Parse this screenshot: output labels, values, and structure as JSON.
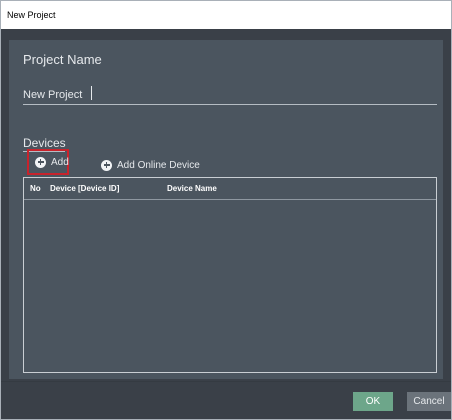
{
  "window": {
    "title": "New Project"
  },
  "project_name": {
    "heading": "Project Name",
    "value": "New Project"
  },
  "devices": {
    "heading": "Devices",
    "add_label": "Add",
    "add_online_label": "Add Online Device",
    "table": {
      "columns": [
        "No",
        "Device [Device ID]",
        "Device Name"
      ],
      "rows": []
    }
  },
  "footer": {
    "ok_label": "OK",
    "cancel_label": "Cancel"
  },
  "colors": {
    "frame": "#3a4048",
    "panel": "#4b555f",
    "ok": "#6da68a",
    "highlight": "#c8232c"
  }
}
